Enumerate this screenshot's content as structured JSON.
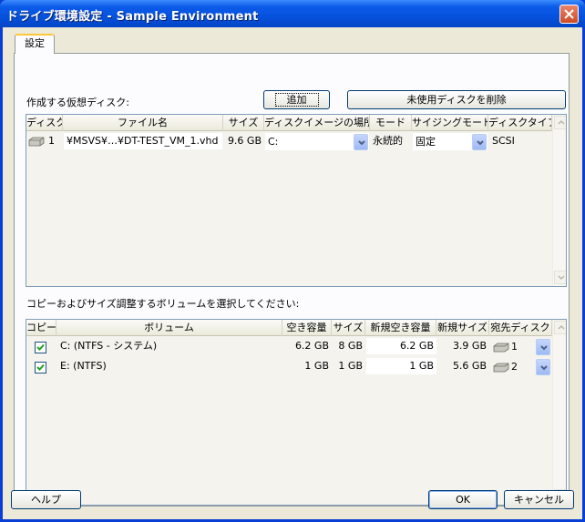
{
  "window": {
    "title": "ドライブ環境設定 - Sample Environment"
  },
  "tabs": [
    {
      "label": "設定"
    }
  ],
  "virtual_disks": {
    "section_label": "作成する仮想ディスク:",
    "add_button": "追加",
    "remove_unused_button": "未使用ディスクを削除",
    "columns": [
      "ディスク",
      "ファイル名",
      "サイズ",
      "ディスクイメージの場所",
      "モード",
      "サイジングモード",
      "ディスクタイプ"
    ],
    "rows": [
      {
        "disk": "1",
        "filename": "¥MSVS¥…¥DT-TEST_VM_1.vhd",
        "size": "9.6 GB",
        "location": "C:",
        "mode": "永続的",
        "sizing_mode": "固定",
        "disk_type": "SCSI"
      }
    ]
  },
  "volumes": {
    "section_label": "コピーおよびサイズ調整するボリュームを選択してください:",
    "columns": [
      "コピー",
      "ボリューム",
      "空き容量",
      "サイズ",
      "新規空き容量",
      "新規サイズ",
      "宛先ディスク"
    ],
    "rows": [
      {
        "copy": true,
        "volume": "C: (NTFS - システム)",
        "free": "6.2 GB",
        "size": "8 GB",
        "new_free": "6.2 GB",
        "new_size": "3.9 GB",
        "dest_disk": "1"
      },
      {
        "copy": true,
        "volume": "E: (NTFS)",
        "free": "1 GB",
        "size": "1 GB",
        "new_free": "1 GB",
        "new_size": "5.6 GB",
        "dest_disk": "2"
      }
    ]
  },
  "footer": {
    "help_button": "ヘルプ",
    "ok_button": "OK",
    "cancel_button": "キャンセル"
  },
  "colors": {
    "titlebar": "#0552de",
    "dialog_bg": "#ece9d8",
    "tab_accent": "#ffc83c",
    "checkbox_check": "#21a121"
  }
}
